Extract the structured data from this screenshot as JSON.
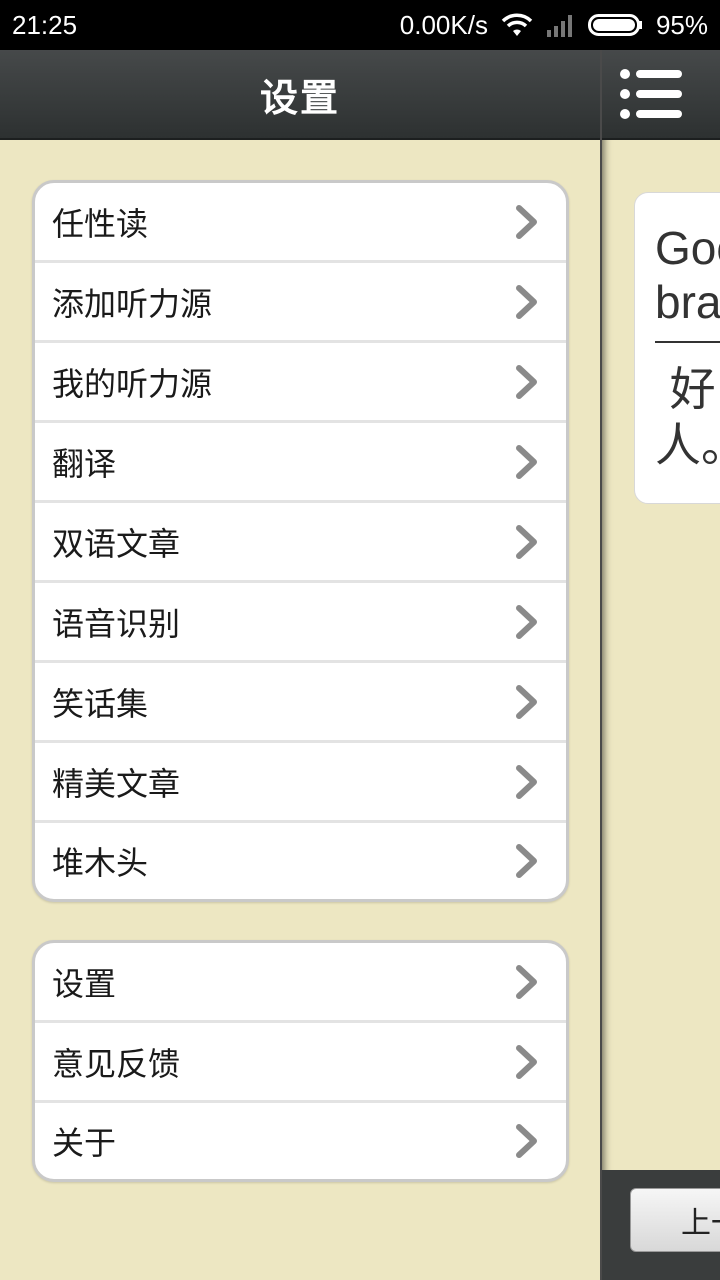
{
  "status_bar": {
    "time": "21:25",
    "net_speed": "0.00K/s",
    "battery": "95%"
  },
  "drawer": {
    "title": "设置",
    "groups": [
      {
        "items": [
          {
            "label": "任性读"
          },
          {
            "label": "添加听力源"
          },
          {
            "label": "我的听力源"
          },
          {
            "label": "翻译"
          },
          {
            "label": "双语文章"
          },
          {
            "label": "语音识别"
          },
          {
            "label": "笑话集"
          },
          {
            "label": "精美文章"
          },
          {
            "label": "堆木头"
          }
        ]
      },
      {
        "items": [
          {
            "label": "设置"
          },
          {
            "label": "意见反馈"
          },
          {
            "label": "关于"
          }
        ]
      }
    ]
  },
  "content": {
    "card_en": "Goo\nbra",
    "card_cn": " 好\n人。",
    "prev_button": "上一"
  },
  "icons": {
    "menu": "hamburger-menu-icon",
    "chevron": "chevron-right-icon",
    "wifi": "wifi-icon",
    "signal": "signal-icon",
    "battery": "battery-icon"
  }
}
